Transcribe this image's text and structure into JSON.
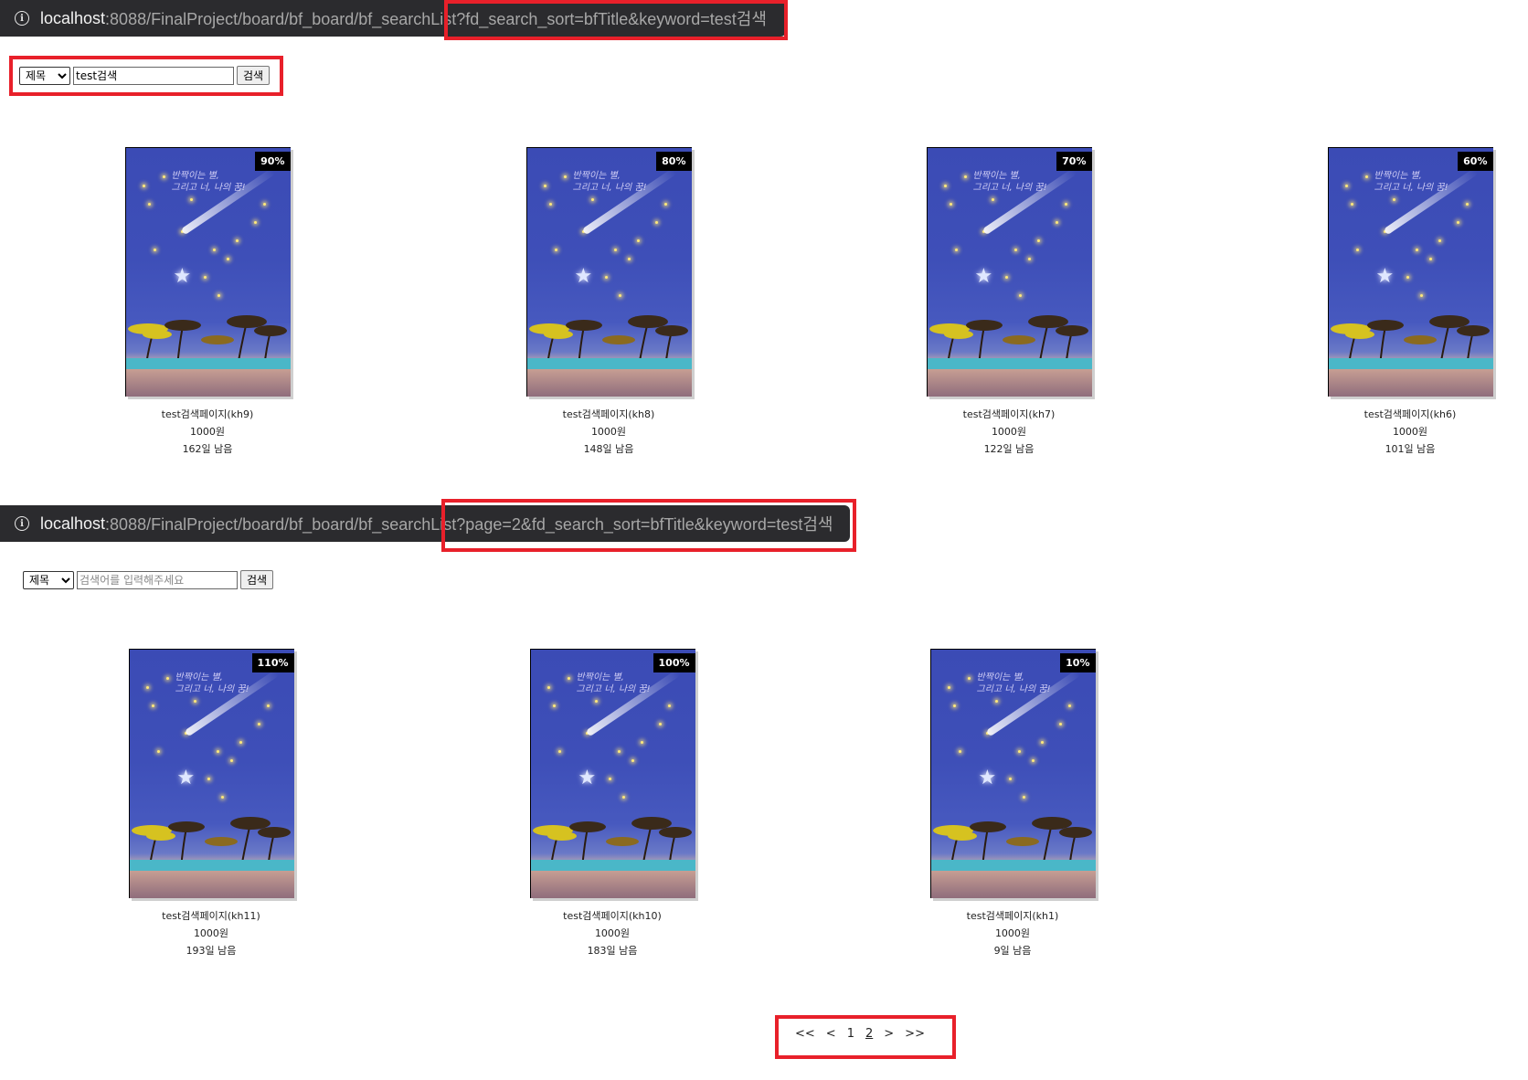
{
  "top": {
    "url_host": "localhost",
    "url_path": ":8088/FinalProject/board/bf_board/bf_searchList?fd_search_sort=bfTitle&keyword=test검색",
    "search": {
      "sort_selected": "제목",
      "keyword_value": "test검색",
      "placeholder": "",
      "button_label": "검색"
    },
    "cards": [
      {
        "percent": "90%",
        "title": "test검색페이지(kh9)",
        "price": "1000원",
        "remaining": "162일 남음"
      },
      {
        "percent": "80%",
        "title": "test검색페이지(kh8)",
        "price": "1000원",
        "remaining": "148일 남음"
      },
      {
        "percent": "70%",
        "title": "test검색페이지(kh7)",
        "price": "1000원",
        "remaining": "122일 남음"
      },
      {
        "percent": "60%",
        "title": "test검색페이지(kh6)",
        "price": "1000원",
        "remaining": "101일 남음"
      }
    ]
  },
  "bottom": {
    "url_host": "localhost",
    "url_path": ":8088/FinalProject/board/bf_board/bf_searchList?page=2&fd_search_sort=bfTitle&keyword=test검색",
    "search": {
      "sort_selected": "제목",
      "keyword_value": "",
      "placeholder": "검색어를 입력해주세요",
      "button_label": "검색"
    },
    "cards": [
      {
        "percent": "110%",
        "title": "test검색페이지(kh11)",
        "price": "1000원",
        "remaining": "193일 남음"
      },
      {
        "percent": "100%",
        "title": "test검색페이지(kh10)",
        "price": "1000원",
        "remaining": "183일 남음"
      },
      {
        "percent": "10%",
        "title": "test검색페이지(kh1)",
        "price": "1000원",
        "remaining": "9일 남음"
      }
    ]
  },
  "pagination": {
    "first": "<<",
    "prev": "<",
    "pages": [
      "1",
      "2"
    ],
    "current": "2",
    "next": ">",
    "last": ">>"
  },
  "colors": {
    "highlight": "#e8202a",
    "urlbar_bg": "#2b2b2e",
    "badge_bg": "#000000"
  }
}
